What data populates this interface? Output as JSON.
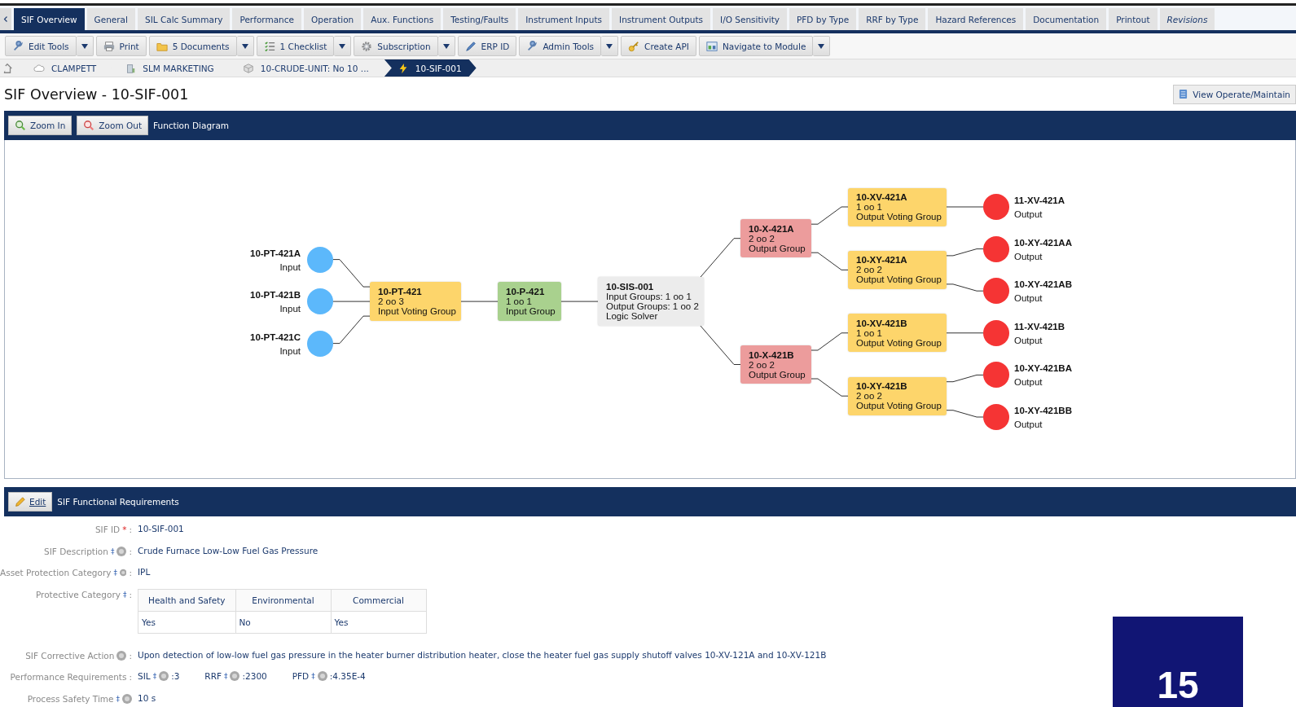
{
  "tabs": [
    {
      "label": "SIF Overview",
      "selected": true,
      "italic": false
    },
    {
      "label": "General",
      "selected": false,
      "italic": false
    },
    {
      "label": "SIL Calc Summary",
      "selected": false,
      "italic": false
    },
    {
      "label": "Performance",
      "selected": false,
      "italic": false
    },
    {
      "label": "Operation",
      "selected": false,
      "italic": false
    },
    {
      "label": "Aux. Functions",
      "selected": false,
      "italic": false
    },
    {
      "label": "Testing/Faults",
      "selected": false,
      "italic": false
    },
    {
      "label": "Instrument Inputs",
      "selected": false,
      "italic": false
    },
    {
      "label": "Instrument Outputs",
      "selected": false,
      "italic": false
    },
    {
      "label": "I/O Sensitivity",
      "selected": false,
      "italic": false
    },
    {
      "label": "PFD by Type",
      "selected": false,
      "italic": false
    },
    {
      "label": "RRF by Type",
      "selected": false,
      "italic": false
    },
    {
      "label": "Hazard References",
      "selected": false,
      "italic": false
    },
    {
      "label": "Documentation",
      "selected": false,
      "italic": false
    },
    {
      "label": "Printout",
      "selected": false,
      "italic": false
    },
    {
      "label": "Revisions",
      "selected": false,
      "italic": true
    }
  ],
  "toolbar": [
    {
      "label": "Edit Tools",
      "dropdown": true
    },
    {
      "label": "Print",
      "dropdown": false
    },
    {
      "label": "5 Documents",
      "dropdown": true
    },
    {
      "label": "1 Checklist",
      "dropdown": true
    },
    {
      "label": "Subscription",
      "dropdown": true
    },
    {
      "label": "ERP ID",
      "dropdown": false
    },
    {
      "label": "Admin Tools",
      "dropdown": true
    },
    {
      "label": "Create API",
      "dropdown": false
    },
    {
      "label": "Navigate to Module",
      "dropdown": true
    }
  ],
  "breadcrumb": [
    {
      "label": "CLAMPETT",
      "selected": false
    },
    {
      "label": "SLM MARKETING",
      "selected": false
    },
    {
      "label": "10-CRUDE-UNIT: No 10 ...",
      "selected": false
    },
    {
      "label": "10-SIF-001",
      "selected": true
    }
  ],
  "page_title": "SIF Overview - 10-SIF-001",
  "view_button": "View Operate/Maintain",
  "diagram_bar": {
    "buttons": [
      "Zoom In",
      "Zoom Out"
    ],
    "title": "Function Diagram"
  },
  "diagram": {
    "inputs": [
      {
        "name": "10-PT-421A",
        "type": "Input"
      },
      {
        "name": "10-PT-421B",
        "type": "Input"
      },
      {
        "name": "10-PT-421C",
        "type": "Input"
      }
    ],
    "input_voting_group": {
      "lines": [
        "10-PT-421",
        "2 oo 3",
        "Input Voting Group"
      ]
    },
    "input_group": {
      "lines": [
        "10-P-421",
        "1 oo 1",
        "Input Group"
      ]
    },
    "logic_solver": {
      "lines": [
        "10-SIS-001",
        "Input Groups: 1 oo 1",
        "Output Groups: 1 oo 2",
        "Logic Solver"
      ]
    },
    "output_groups": [
      {
        "lines": [
          "10-X-421A",
          "2 oo 2",
          "Output Group"
        ],
        "voting_groups": [
          {
            "lines": [
              "10-XV-421A",
              "1 oo 1",
              "Output Voting Group"
            ],
            "outputs": [
              {
                "name": "11-XV-421A",
                "type": "Output"
              }
            ]
          },
          {
            "lines": [
              "10-XY-421A",
              "2 oo 2",
              "Output Voting Group"
            ],
            "outputs": [
              {
                "name": "10-XY-421AA",
                "type": "Output"
              },
              {
                "name": "10-XY-421AB",
                "type": "Output"
              }
            ]
          }
        ]
      },
      {
        "lines": [
          "10-X-421B",
          "2 oo 2",
          "Output Group"
        ],
        "voting_groups": [
          {
            "lines": [
              "10-XV-421B",
              "1 oo 1",
              "Output Voting Group"
            ],
            "outputs": [
              {
                "name": "11-XV-421B",
                "type": "Output"
              }
            ]
          },
          {
            "lines": [
              "10-XY-421B",
              "2 oo 2",
              "Output Voting Group"
            ],
            "outputs": [
              {
                "name": "10-XY-421BA",
                "type": "Output"
              },
              {
                "name": "10-XY-421BB",
                "type": "Output"
              }
            ]
          }
        ]
      }
    ]
  },
  "requirements_bar": {
    "edit_button": "Edit",
    "title": "SIF Functional Requirements"
  },
  "requirements": [
    {
      "kind": "text",
      "label": "SIF ID",
      "marker": "*",
      "required": true,
      "help": false,
      "colon": ":",
      "value": "10-SIF-001"
    },
    {
      "kind": "text",
      "label": "SIF Description",
      "marker": "‡",
      "required": false,
      "help": true,
      "colon": ":",
      "value": "Crude Furnace Low-Low Fuel Gas Pressure"
    },
    {
      "kind": "text",
      "label": "Asset Protection Category",
      "marker": "‡",
      "required": false,
      "help": true,
      "colon": ":",
      "value": "IPL"
    },
    {
      "kind": "table",
      "label": "Protective Category",
      "marker": "‡",
      "required": false,
      "help": false,
      "colon": ":",
      "columns": [
        "Health and Safety",
        "Environmental",
        "Commercial"
      ],
      "values": [
        "Yes",
        "No",
        "Yes"
      ]
    },
    {
      "kind": "text",
      "label": "SIF Corrective Action",
      "help": true,
      "colon": ":",
      "value": "Upon detection of low-low fuel gas pressure in the heater burner distribution heater, close the heater fuel gas supply shutoff valves 10-XV-121A and 10-XV-121B"
    },
    {
      "kind": "metrics",
      "label": "Performance Requirements",
      "help": false,
      "colon": ":",
      "items": [
        {
          "label": "SIL",
          "marker": "‡",
          "value": ":3"
        },
        {
          "label": "RRF",
          "marker": "‡",
          "value": ":2300"
        },
        {
          "label": "PFD",
          "marker": "‡",
          "value": ":4.35E-4"
        }
      ]
    },
    {
      "kind": "text",
      "label": "Process Safety Time",
      "marker": "‡",
      "required": false,
      "help": true,
      "value": "10 s"
    }
  ],
  "slide_number": "15"
}
